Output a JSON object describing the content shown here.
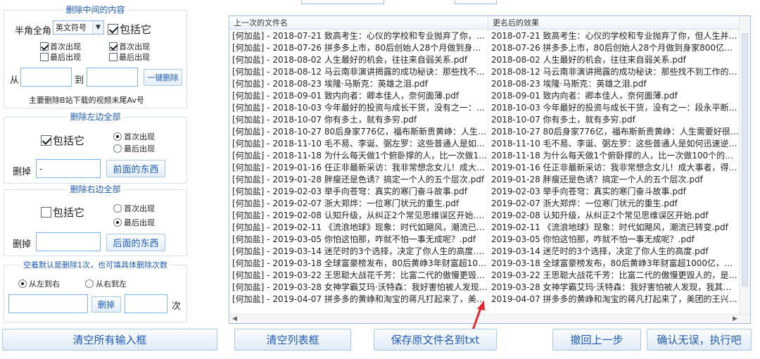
{
  "left": {
    "group_middle": {
      "title": "删除中间的内容",
      "width_label": "半角全角",
      "symbol_select": "英文符号",
      "include_label": "包括它",
      "left_first": "首次出现",
      "left_last": "最后出现",
      "right_first": "首次出现",
      "right_last": "最后出现",
      "from_label": "从",
      "to_label": "到",
      "one_click_delete": "一键删除",
      "note": "主要删除B站下载的视频末尾Av号"
    },
    "group_left": {
      "title": "删除左边全部",
      "include_label": "包括它",
      "first": "首次出现",
      "last": "最后出现",
      "delete_label": "删掉",
      "delete_value": "-",
      "button": "前面的东西"
    },
    "group_right": {
      "title": "删除右边全部",
      "include_label": "包括它",
      "first": "首次出现",
      "last": "最后出现",
      "delete_label": "删掉",
      "delete_value": "",
      "button": "后面的东西"
    },
    "group_count": {
      "title": "空着默认是删除1次，也可填具体删除次数",
      "left_to_right": "从左到右",
      "right_to_left": "从右到左",
      "delete_button": "删掉",
      "times_label": "次"
    }
  },
  "list": {
    "col1_header": "上一次的文件名",
    "col2_header": "更名后的效果",
    "rows": [
      [
        "[何加盐] - 2018-07-21 致高考生：心仪的学校和专业抛弃了你，但...",
        "2018-07-21 致高考生：心仪的学校和专业抛弃了你，但人生并没..."
      ],
      [
        "[何加盐] - 2018-07-26 拼多多上市，80后创始人28个月做到身家80...",
        "2018-07-26 拼多多上市，80后创始人28个月做到身家800亿，凭..."
      ],
      [
        "[何加盐] - 2018-08-02 人生最好的机会，往往来自弱关系.pdf",
        "2018-08-02 人生最好的机会，往往来自弱关系.pdf"
      ],
      [
        "[何加盐] - 2018-08-12 马云南非演讲揭露的成功秘诀：那些找不到...",
        "2018-08-12 马云南非演讲揭露的成功秘诀：那些找不到工作的人..."
      ],
      [
        "[何加盐] - 2018-08-23 埃隆·马斯克：英雄之泪.pdf",
        "2018-08-23 埃隆·马斯克：英雄之泪.pdf"
      ],
      [
        "[何加盐] - 2018-09-01 致内向者：卿本佳人，奈何面薄.pdf",
        "2018-09-01 致内向者：卿本佳人，奈何面薄.pdf"
      ],
      [
        "[何加盐] - 2018-10-03 今年最好的投资与成长干货，没有之一：段...",
        "2018-10-03 今年最好的投资与成长干货，没有之一：段永平断坦..."
      ],
      [
        "[何加盐] - 2018-10-07 你有多土，就有多穷.pdf",
        "2018-10-07 你有多土，就有多穷.pdf"
      ],
      [
        "[何加盐] - 2018-10-27 80后身家776亿，福布斯新贵黄峥：人生需...",
        "2018-10-27 80后身家776亿，福布斯新贵黄峥：人生需要好很头..."
      ],
      [
        "[何加盐] - 2018-11-10 毛不易、李诞、弼左罗：这些普通人是如何...",
        "2018-11-10 毛不易、李诞、弼左罗：这些普通人是如何迅速逆袭..."
      ],
      [
        "[何加盐] - 2018-11-18 为什么每天做1个俯卧撑的人，比一次做100...",
        "2018-11-18 为什么每天做1个俯卧撑的人，比一次做100个的更牛..."
      ],
      [
        "[何加盐] - 2019-01-16 任正非最新采访：我非常想念女儿！成大事...",
        "2019-01-16 任正非最新采访：我非常想念女儿！成大事者，得受..."
      ],
      [
        "[何加盐] - 2019-01-28 胖瘦还是色诱？搞定一个人的五个层次.pdf",
        "2019-01-28 胖瘦还是色诱？搞定一个人的五个层次.pdf"
      ],
      [
        "[何加盐] - 2019-02-03 举手向苍穹：真实的寒门奋斗故事.pdf",
        "2019-02-03 举手向苍穹：真实的寒门奋斗故事.pdf"
      ],
      [
        "[何加盐] - 2019-02-07 浙大郑烨：一位寒门状元的重生.pdf",
        "2019-02-07 浙大郑烨：一位寒门状元的重生.pdf"
      ],
      [
        "[何加盐] - 2019-02-08 认知升级，从纠正2个常见思维误区开始.pdf",
        "2019-02-08 认知升级，从纠正2个常见思维误区开始.pdf"
      ],
      [
        "[何加盐] - 2019-02-11 《流浪地球》现象：时代如飓风，潮流已转...",
        "2019-02-11 《流浪地球》现象：时代如飓风，潮流已转变.pdf"
      ],
      [
        "[何加盐] - 2019-03-05 你怕这怕那，咋就不怕一事无成呢？.pdf",
        "2019-03-05 你怕这怕那，咋就不怕一事无成呢？.pdf"
      ],
      [
        "[何加盐] - 2019-03-14 迷茫时的3个选择，决定了你人生的高度.pdf",
        "2019-03-14 迷茫时的3个选择，决定了你人生的高度.pdf"
      ],
      [
        "[何加盐] - 2019-03-18 全球富豪榜发布，80后黄峥3年财富超1000...",
        "2019-03-18 全球富豪榜发布，80后黄峥3年财富超1000亿，凭的..."
      ],
      [
        "[何加盐] - 2019-03-22 王思聪大战花千芳：比富二代的傲慢更毁人...",
        "2019-03-22 王思聪大战花千芳：比富二代的傲慢更毁人的，是穷..."
      ],
      [
        "[何加盐] - 2019-03-28 女神学霸艾玛·沃特森：我好害怕被人发现，...",
        "2019-03-28 女神学霸艾玛·沃特森：我好害怕被人发现，我其实是..."
      ],
      [
        "[何加盐] - 2019-04-07 拼多多的黄峥和淘宝的蒋凡打起来了，美团...",
        "2019-04-07 拼多多的黄峥和淘宝的蒋凡打起来了，美团的王兴在..."
      ]
    ]
  },
  "bottom": {
    "clear_inputs": "清空所有输入框",
    "clear_list": "清空列表框",
    "save_names": "保存原文件名到txt",
    "undo": "撤回上一步",
    "execute": "确认无误，执行吧"
  },
  "colors": {
    "accent_text": "#1e5bb8",
    "border_blue": "#7eb4ea",
    "arrow_red": "#e0282e"
  }
}
